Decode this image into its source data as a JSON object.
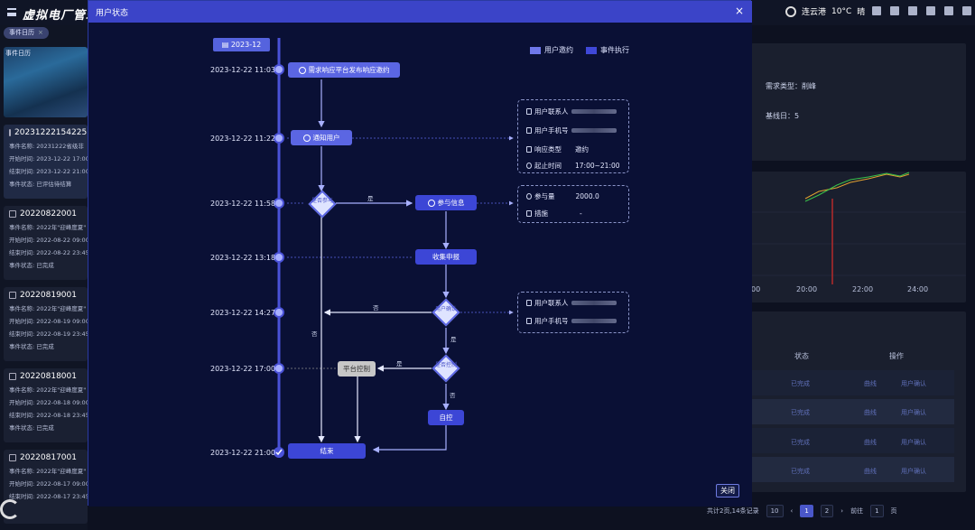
{
  "app": {
    "title": "虚拟电厂管理"
  },
  "weather": {
    "location": "连云港",
    "temp": "10°C",
    "condition": "晴"
  },
  "left": {
    "tag": "事件日历",
    "image_label": "事件日历",
    "cards": [
      {
        "id": "20231222154225",
        "lines": [
          "事件名称: 20231222省级非",
          "开始时间: 2023-12-22 17:00",
          "结束时间: 2023-12-22 21:00",
          "事件状态: 已评估待结算"
        ]
      },
      {
        "id": "20220822001",
        "lines": [
          "事件名称: 2022年\"迎峰度夏\"",
          "开始时间: 2022-08-22 09:00",
          "结束时间: 2022-08-22 23:45",
          "事件状态: 已完成"
        ]
      },
      {
        "id": "20220819001",
        "lines": [
          "事件名称: 2022年\"迎峰度夏\"",
          "开始时间: 2022-08-19 09:00",
          "结束时间: 2022-08-19 23:45",
          "事件状态: 已完成"
        ]
      },
      {
        "id": "20220818001",
        "lines": [
          "事件名称: 2022年\"迎峰度夏\"",
          "开始时间: 2022-08-18 09:00",
          "结束时间: 2022-08-18 23:45",
          "事件状态: 已完成"
        ]
      },
      {
        "id": "20220817001",
        "lines": [
          "事件名称: 2022年\"迎峰度夏\"",
          "开始时间: 2022-08-17 09:00",
          "结束时间: 2022-08-17 23:45"
        ]
      }
    ]
  },
  "right": {
    "demand_type": "需求类型：削峰",
    "baseline": "基线日：5",
    "chart_ticks": [
      "00",
      "20:00",
      "22:00",
      "24:00"
    ],
    "table_headers": [
      "状态",
      "操作"
    ],
    "rows": [
      {
        "status": "已完成",
        "a1": "曲线",
        "a2": "用户确认"
      },
      {
        "status": "已完成",
        "a1": "曲线",
        "a2": "用户确认"
      },
      {
        "status": "已完成",
        "a1": "曲线",
        "a2": "用户确认"
      },
      {
        "status": "已完成",
        "a1": "曲线",
        "a2": "用户确认"
      }
    ],
    "pager": {
      "total": "共计2页,14条记录",
      "size": "10",
      "pages": [
        "1",
        "2"
      ],
      "goto_label": "前往",
      "goto_value": "1",
      "page_suffix": "页"
    }
  },
  "modal": {
    "title": "用户状态",
    "close_label": "关闭",
    "date_badge": "2023-12",
    "legend": [
      "用户邀约",
      "事件执行"
    ],
    "times": [
      "2023-12-22 11:03",
      "2023-12-22 11:22",
      "2023-12-22 11:58",
      "2023-12-22 13:18",
      "2023-12-22 14:27",
      "2023-12-22 17:00",
      "2023-12-22 21:00"
    ],
    "nodes": {
      "publish": "需求响应平台发布响应邀约",
      "notify": "通知用户",
      "participate_info": "参与信息",
      "collect": "收集申报",
      "platform_control": "平台控制",
      "self_control": "自控",
      "end": "结束"
    },
    "diamonds": {
      "d1": "是否参与",
      "d2": "用户确认",
      "d3": "是否控制"
    },
    "edge_labels": {
      "yes1": "是",
      "no1": "否",
      "no2": "否",
      "yes2": "是",
      "yes3": "是",
      "no3": "否"
    },
    "info1": {
      "contact_label": "用户联系人",
      "phone_label": "用户手机号",
      "type_label": "响应类型",
      "type_value": "邀约",
      "time_label": "起止时间",
      "time_value": "17:00~21:00"
    },
    "info2": {
      "amount_label": "参与量",
      "amount_value": "2000.0",
      "measure_label": "措施",
      "measure_value": "-"
    },
    "info3": {
      "contact_label": "用户联系人",
      "phone_label": "用户手机号"
    }
  },
  "colors": {
    "accent": "#5b66e3",
    "header": "#3b44c8",
    "modal_bg": "#0a1035"
  }
}
